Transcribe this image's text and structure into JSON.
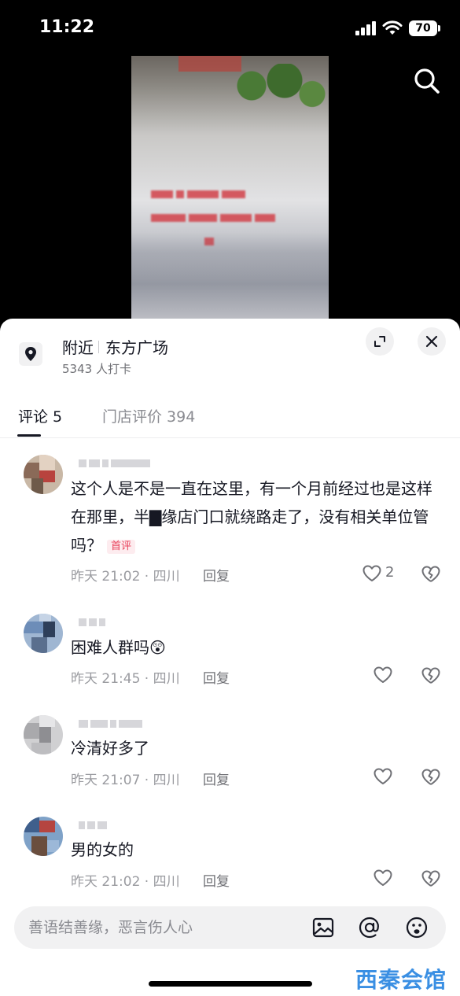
{
  "status_bar": {
    "time": "11:22",
    "battery": "70"
  },
  "location": {
    "label": "附近",
    "name": "东方广场",
    "checkins": "5343 人打卡"
  },
  "tabs": [
    {
      "label": "评论 5",
      "active": true
    },
    {
      "label": "门店评价 394",
      "active": false
    }
  ],
  "comments": [
    {
      "text": "这个人是不是一直在这里，有一个月前经过也是这样在那里，半▇缘店门口就绕路走了，没有相关单位管吗？",
      "badge": "首评",
      "meta": "昨天 21:02 · 四川",
      "reply": "回复",
      "likes": "2"
    },
    {
      "text": "困难人群吗😲",
      "meta": "昨天 21:45 · 四川",
      "reply": "回复",
      "likes": ""
    },
    {
      "text": "冷清好多了",
      "meta": "昨天 21:07 · 四川",
      "reply": "回复",
      "likes": ""
    },
    {
      "text": "男的女的",
      "meta": "昨天 21:02 · 四川",
      "reply": "回复",
      "likes": ""
    }
  ],
  "input": {
    "placeholder": "善语结善缘，恶言伤人心"
  },
  "watermark": "西秦会馆",
  "icons": [
    "search-icon",
    "location-pin-icon",
    "expand-icon",
    "close-icon",
    "heart-icon",
    "broken-heart-icon",
    "image-icon",
    "at-icon",
    "emoji-icon"
  ]
}
